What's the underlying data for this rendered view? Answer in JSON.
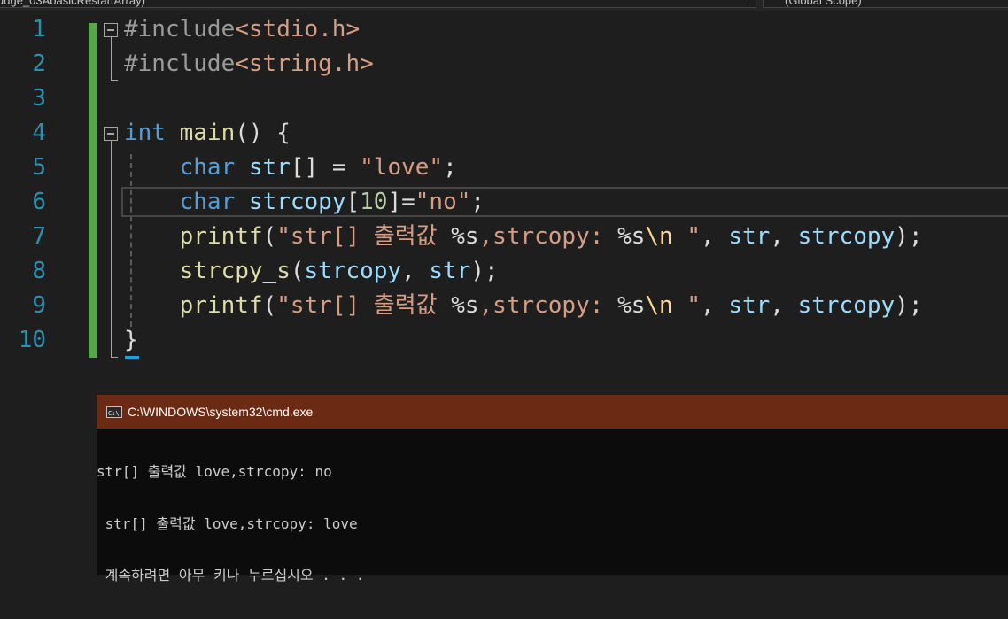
{
  "navbar": {
    "file_combo": "udge_03AbasicRestartArray)",
    "scope_combo": "(Global Scope)"
  },
  "editor": {
    "line_numbers": [
      "1",
      "2",
      "3",
      "4",
      "5",
      "6",
      "7",
      "8",
      "9",
      "10"
    ]
  },
  "code": {
    "l1": {
      "directive": "#include",
      "header": "<stdio.h>"
    },
    "l2": {
      "directive": "#include",
      "header": "<string.h>"
    },
    "l4": {
      "type": "int",
      "sp": " ",
      "fn": "main",
      "rest": "() {"
    },
    "l5": {
      "indent": "    ",
      "type": "char",
      "sp": " ",
      "var": "str",
      "rest": "[] = ",
      "str": "\"love\"",
      "end": ";"
    },
    "l6": {
      "indent": "    ",
      "type": "char",
      "sp": " ",
      "var": "strcopy",
      "open": "[",
      "num": "10",
      "close": "]=",
      "str": "\"no\"",
      "end": ";"
    },
    "l7": {
      "indent": "    ",
      "fn": "printf",
      "open": "(",
      "str1": "\"str[] 출력값 ",
      "fmt1": "%s",
      "str2": ",strcopy: ",
      "fmt2": "%s",
      "esc": "\\n",
      "str3": " \"",
      "comma1": ", ",
      "var1": "str",
      "comma2": ", ",
      "var2": "strcopy",
      "end": ");"
    },
    "l8": {
      "indent": "    ",
      "fn": "strcpy_s",
      "open": "(",
      "var1": "strcopy",
      "comma": ", ",
      "var2": "str",
      "end": ");"
    },
    "l9": {
      "indent": "    ",
      "fn": "printf",
      "open": "(",
      "str1": "\"str[] 출력값 ",
      "fmt1": "%s",
      "str2": ",strcopy: ",
      "fmt2": "%s",
      "esc": "\\n",
      "str3": " \"",
      "comma1": ", ",
      "var1": "str",
      "comma2": ", ",
      "var2": "strcopy",
      "end": ");"
    },
    "l10": {
      "brace": "}"
    }
  },
  "console": {
    "title": "C:\\WINDOWS\\system32\\cmd.exe",
    "lines": [
      "str[] 출력값 love,strcopy: no",
      " str[] 출력값 love,strcopy: love",
      " 계속하려면 아무 키나 누르십시오 . . ."
    ]
  },
  "colors": {
    "keyword": "#569cd6",
    "function": "#dcdcaa",
    "variable": "#9cdcfe",
    "string": "#d69d85",
    "number": "#b5cea8",
    "escape": "#ffd68f",
    "line_number": "#2b91af",
    "change_bar": "#57a64a",
    "console_title_bg": "#6b2a14"
  }
}
